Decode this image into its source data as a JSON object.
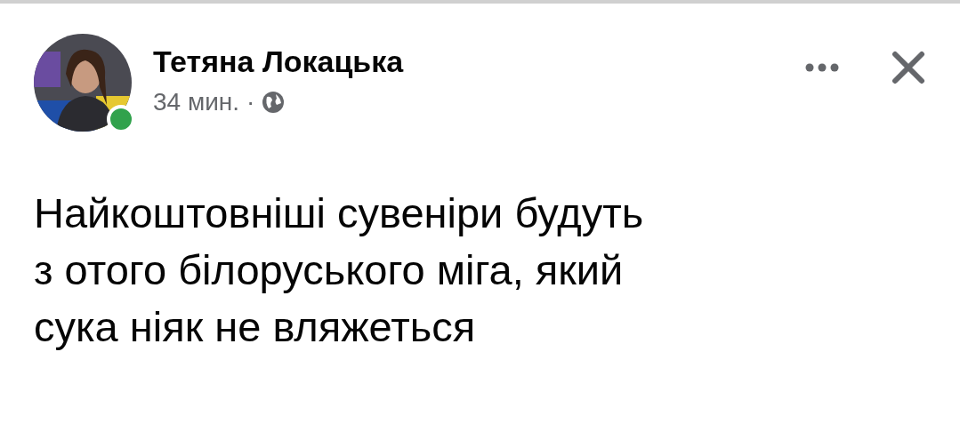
{
  "post": {
    "author": "Тетяна Локацька",
    "online": true,
    "time": "34 мин.",
    "separator": "·",
    "text": "Найкоштовніші сувеніри будуть\nз отого білоруського міга, який\nсука ніяк не вляжеться"
  }
}
